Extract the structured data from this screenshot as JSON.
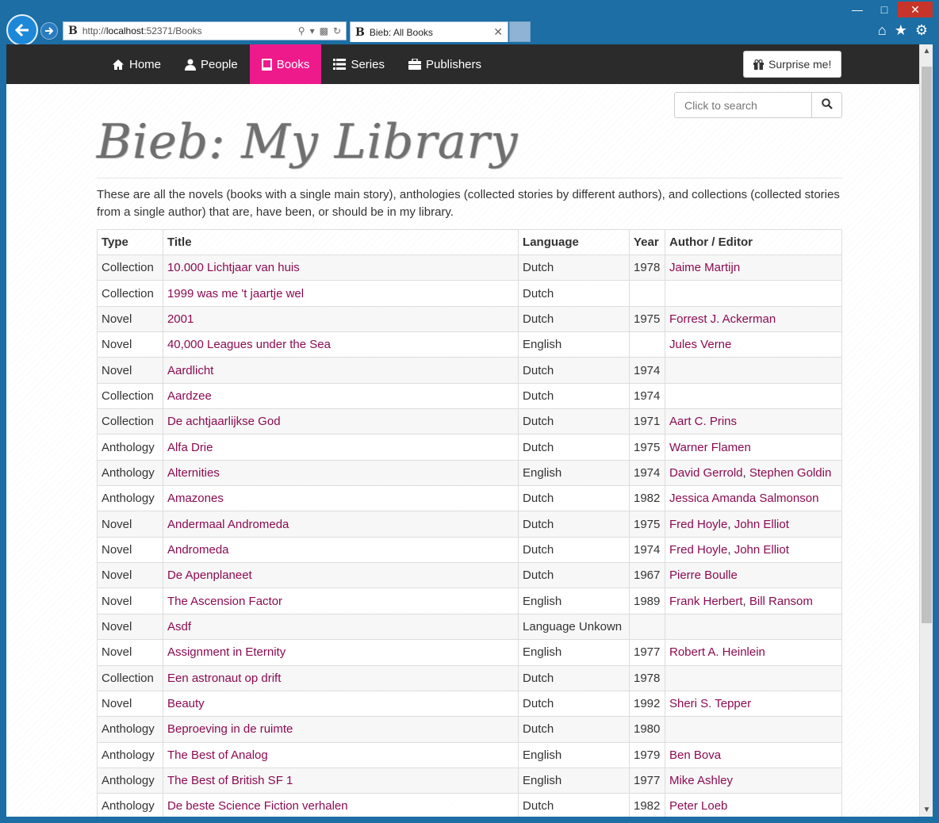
{
  "browser": {
    "address_url_prefix": "http://",
    "address_host": "localhost",
    "address_rest": ":52371/Books",
    "favicon": "B",
    "tab_title": "Bieb: All Books"
  },
  "nav": {
    "items": [
      {
        "label": "Home",
        "icon": "home-icon"
      },
      {
        "label": "People",
        "icon": "user-icon"
      },
      {
        "label": "Books",
        "icon": "book-icon"
      },
      {
        "label": "Series",
        "icon": "list-icon"
      },
      {
        "label": "Publishers",
        "icon": "briefcase-icon"
      }
    ],
    "active": "Books",
    "surprise_label": "Surprise me!"
  },
  "search": {
    "placeholder": "Click to search"
  },
  "header": {
    "brand": "Bieb: My Library"
  },
  "intro": "These are all the novels (books with a single main story), anthologies (collected stories by different authors), and collections (collected stories from a single author) that are, have been, or should be in my library.",
  "table": {
    "headers": [
      "Type",
      "Title",
      "Language",
      "Year",
      "Author / Editor"
    ],
    "rows": [
      {
        "type": "Collection",
        "title": "10.000 Lichtjaar van huis",
        "language": "Dutch",
        "year": "1978",
        "authors": [
          "Jaime Martijn"
        ]
      },
      {
        "type": "Collection",
        "title": "1999 was me 't jaartje wel",
        "language": "Dutch",
        "year": "",
        "authors": []
      },
      {
        "type": "Novel",
        "title": "2001",
        "language": "Dutch",
        "year": "1975",
        "authors": [
          "Forrest J. Ackerman"
        ]
      },
      {
        "type": "Novel",
        "title": "40,000 Leagues under the Sea",
        "language": "English",
        "year": "",
        "authors": [
          "Jules Verne"
        ]
      },
      {
        "type": "Novel",
        "title": "Aardlicht",
        "language": "Dutch",
        "year": "1974",
        "authors": []
      },
      {
        "type": "Collection",
        "title": "Aardzee",
        "language": "Dutch",
        "year": "1974",
        "authors": []
      },
      {
        "type": "Collection",
        "title": "De achtjaarlijkse God",
        "language": "Dutch",
        "year": "1971",
        "authors": [
          "Aart C. Prins"
        ]
      },
      {
        "type": "Anthology",
        "title": "Alfa Drie",
        "language": "Dutch",
        "year": "1975",
        "authors": [
          "Warner Flamen"
        ]
      },
      {
        "type": "Anthology",
        "title": "Alternities",
        "language": "English",
        "year": "1974",
        "authors": [
          "David Gerrold",
          "Stephen Goldin"
        ]
      },
      {
        "type": "Anthology",
        "title": "Amazones",
        "language": "Dutch",
        "year": "1982",
        "authors": [
          "Jessica Amanda Salmonson"
        ]
      },
      {
        "type": "Novel",
        "title": "Andermaal Andromeda",
        "language": "Dutch",
        "year": "1975",
        "authors": [
          "Fred Hoyle",
          "John Elliot"
        ]
      },
      {
        "type": "Novel",
        "title": "Andromeda",
        "language": "Dutch",
        "year": "1974",
        "authors": [
          "Fred Hoyle",
          "John Elliot"
        ]
      },
      {
        "type": "Novel",
        "title": "De Apenplaneet",
        "language": "Dutch",
        "year": "1967",
        "authors": [
          "Pierre Boulle"
        ]
      },
      {
        "type": "Novel",
        "title": "The Ascension Factor",
        "language": "English",
        "year": "1989",
        "authors": [
          "Frank Herbert",
          "Bill Ransom"
        ]
      },
      {
        "type": "Novel",
        "title": "Asdf",
        "language": "Language Unkown",
        "year": "",
        "authors": []
      },
      {
        "type": "Novel",
        "title": "Assignment in Eternity",
        "language": "English",
        "year": "1977",
        "authors": [
          "Robert A. Heinlein"
        ]
      },
      {
        "type": "Collection",
        "title": "Een astronaut op drift",
        "language": "Dutch",
        "year": "1978",
        "authors": []
      },
      {
        "type": "Novel",
        "title": "Beauty",
        "language": "Dutch",
        "year": "1992",
        "authors": [
          "Sheri S. Tepper"
        ]
      },
      {
        "type": "Anthology",
        "title": "Beproeving in de ruimte",
        "language": "Dutch",
        "year": "1980",
        "authors": []
      },
      {
        "type": "Anthology",
        "title": "The Best of Analog",
        "language": "English",
        "year": "1979",
        "authors": [
          "Ben Bova"
        ]
      },
      {
        "type": "Anthology",
        "title": "The Best of British SF 1",
        "language": "English",
        "year": "1977",
        "authors": [
          "Mike Ashley"
        ]
      },
      {
        "type": "Anthology",
        "title": "De beste Science Fiction verhalen",
        "language": "Dutch",
        "year": "1982",
        "authors": [
          "Peter Loeb"
        ]
      }
    ]
  },
  "colors": {
    "accent": "#ee1a8c",
    "link": "#8b0b51",
    "navbar": "#2b2b2b",
    "chrome": "#1c6ea4"
  }
}
